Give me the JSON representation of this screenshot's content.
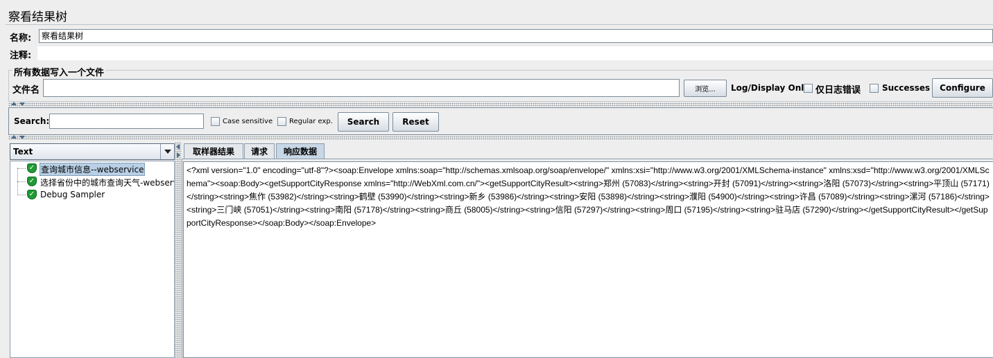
{
  "window": {
    "title": "察看结果树"
  },
  "form": {
    "name_label": "名称:",
    "name_value": "察看结果树",
    "comment_label": "注释:",
    "comment_value": ""
  },
  "file_section": {
    "title": "所有数据写入一个文件",
    "filename_label": "文件名",
    "filename_value": "",
    "browse_label": "浏览...",
    "log_display_label": "Log/Display Only:",
    "errors_only_label": "仅日志错误",
    "successes_label": "Successes",
    "configure_label": "Configure"
  },
  "search": {
    "label": "Search:",
    "value": "",
    "case_sensitive_label": "Case sensitive",
    "regex_label": "Regular exp.",
    "search_button": "Search",
    "reset_button": "Reset"
  },
  "renderer": {
    "selected": "Text"
  },
  "tree": {
    "items": [
      {
        "label": "查询城市信息--webservice",
        "selected": true
      },
      {
        "label": "选择省份中的城市查询天气-webservice",
        "selected": false
      },
      {
        "label": "Debug Sampler",
        "selected": false
      }
    ]
  },
  "tabs": [
    {
      "label": "取样器结果",
      "active": false
    },
    {
      "label": "请求",
      "active": false
    },
    {
      "label": "响应数据",
      "active": true
    }
  ],
  "response": {
    "text": "<?xml version=\"1.0\" encoding=\"utf-8\"?><soap:Envelope xmlns:soap=\"http://schemas.xmlsoap.org/soap/envelope/\" xmlns:xsi=\"http://www.w3.org/2001/XMLSchema-instance\" xmlns:xsd=\"http://www.w3.org/2001/XMLSchema\"><soap:Body><getSupportCityResponse xmlns=\"http://WebXml.com.cn/\"><getSupportCityResult><string>郑州 (57083)</string><string>开封 (57091)</string><string>洛阳 (57073)</string><string>平顶山 (57171)</string><string>焦作 (53982)</string><string>鹤壁 (53990)</string><string>新乡 (53986)</string><string>安阳 (53898)</string><string>濮阳 (54900)</string><string>许昌 (57089)</string><string>漯河 (57186)</string><string>三门峡 (57051)</string><string>南阳 (57178)</string><string>商丘 (58005)</string><string>信阳 (57297)</string><string>周口 (57195)</string><string>驻马店 (57290)</string></getSupportCityResult></getSupportCityResponse></soap:Body></soap:Envelope>"
  },
  "colors": {
    "background": "#eeeeee",
    "selection": "#b8cfe5",
    "success_icon": "#1f9a35"
  }
}
